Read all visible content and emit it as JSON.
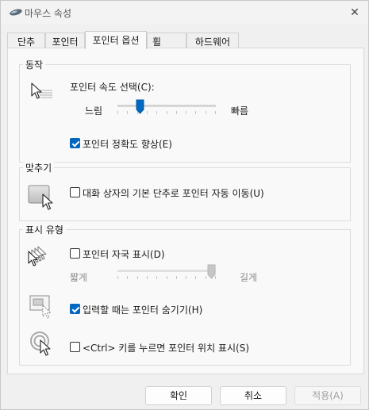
{
  "window": {
    "title": "마우스 속성",
    "close_symbol": "✕"
  },
  "tabs": [
    {
      "label": "단추"
    },
    {
      "label": "포인터"
    },
    {
      "label": "포인터 옵션",
      "active": true
    },
    {
      "label": "휠"
    },
    {
      "label": "하드웨어"
    }
  ],
  "motion": {
    "group_title": "동작",
    "speed_label": "포인터 속도 선택(C):",
    "slow_label": "느림",
    "fast_label": "빠름",
    "speed_level": 0.2,
    "enhance_precision": {
      "label": "포인터 정확도 향상(E)",
      "checked": true
    }
  },
  "snap_to": {
    "group_title": "맞추기",
    "option": {
      "label": "대화 상자의 기본 단추로 포인터 자동 이동(U)",
      "checked": false
    }
  },
  "visibility": {
    "group_title": "표시 유형",
    "trails": {
      "label": "포인터 자국 표시(D)",
      "checked": false
    },
    "trail_short_label": "짧게",
    "trail_long_label": "길게",
    "trail_level": 1.0,
    "hide_typing": {
      "label": "입력할 때는 포인터 숨기기(H)",
      "checked": true
    },
    "show_ctrl": {
      "label": "<Ctrl> 키를 누르면 포인터 위치 표시(S)",
      "checked": false
    }
  },
  "buttons": {
    "ok": "확인",
    "cancel": "취소",
    "apply": "적용(A)"
  },
  "colors": {
    "accent": "#0067c0",
    "disabled_text": "#a0a0a0"
  }
}
